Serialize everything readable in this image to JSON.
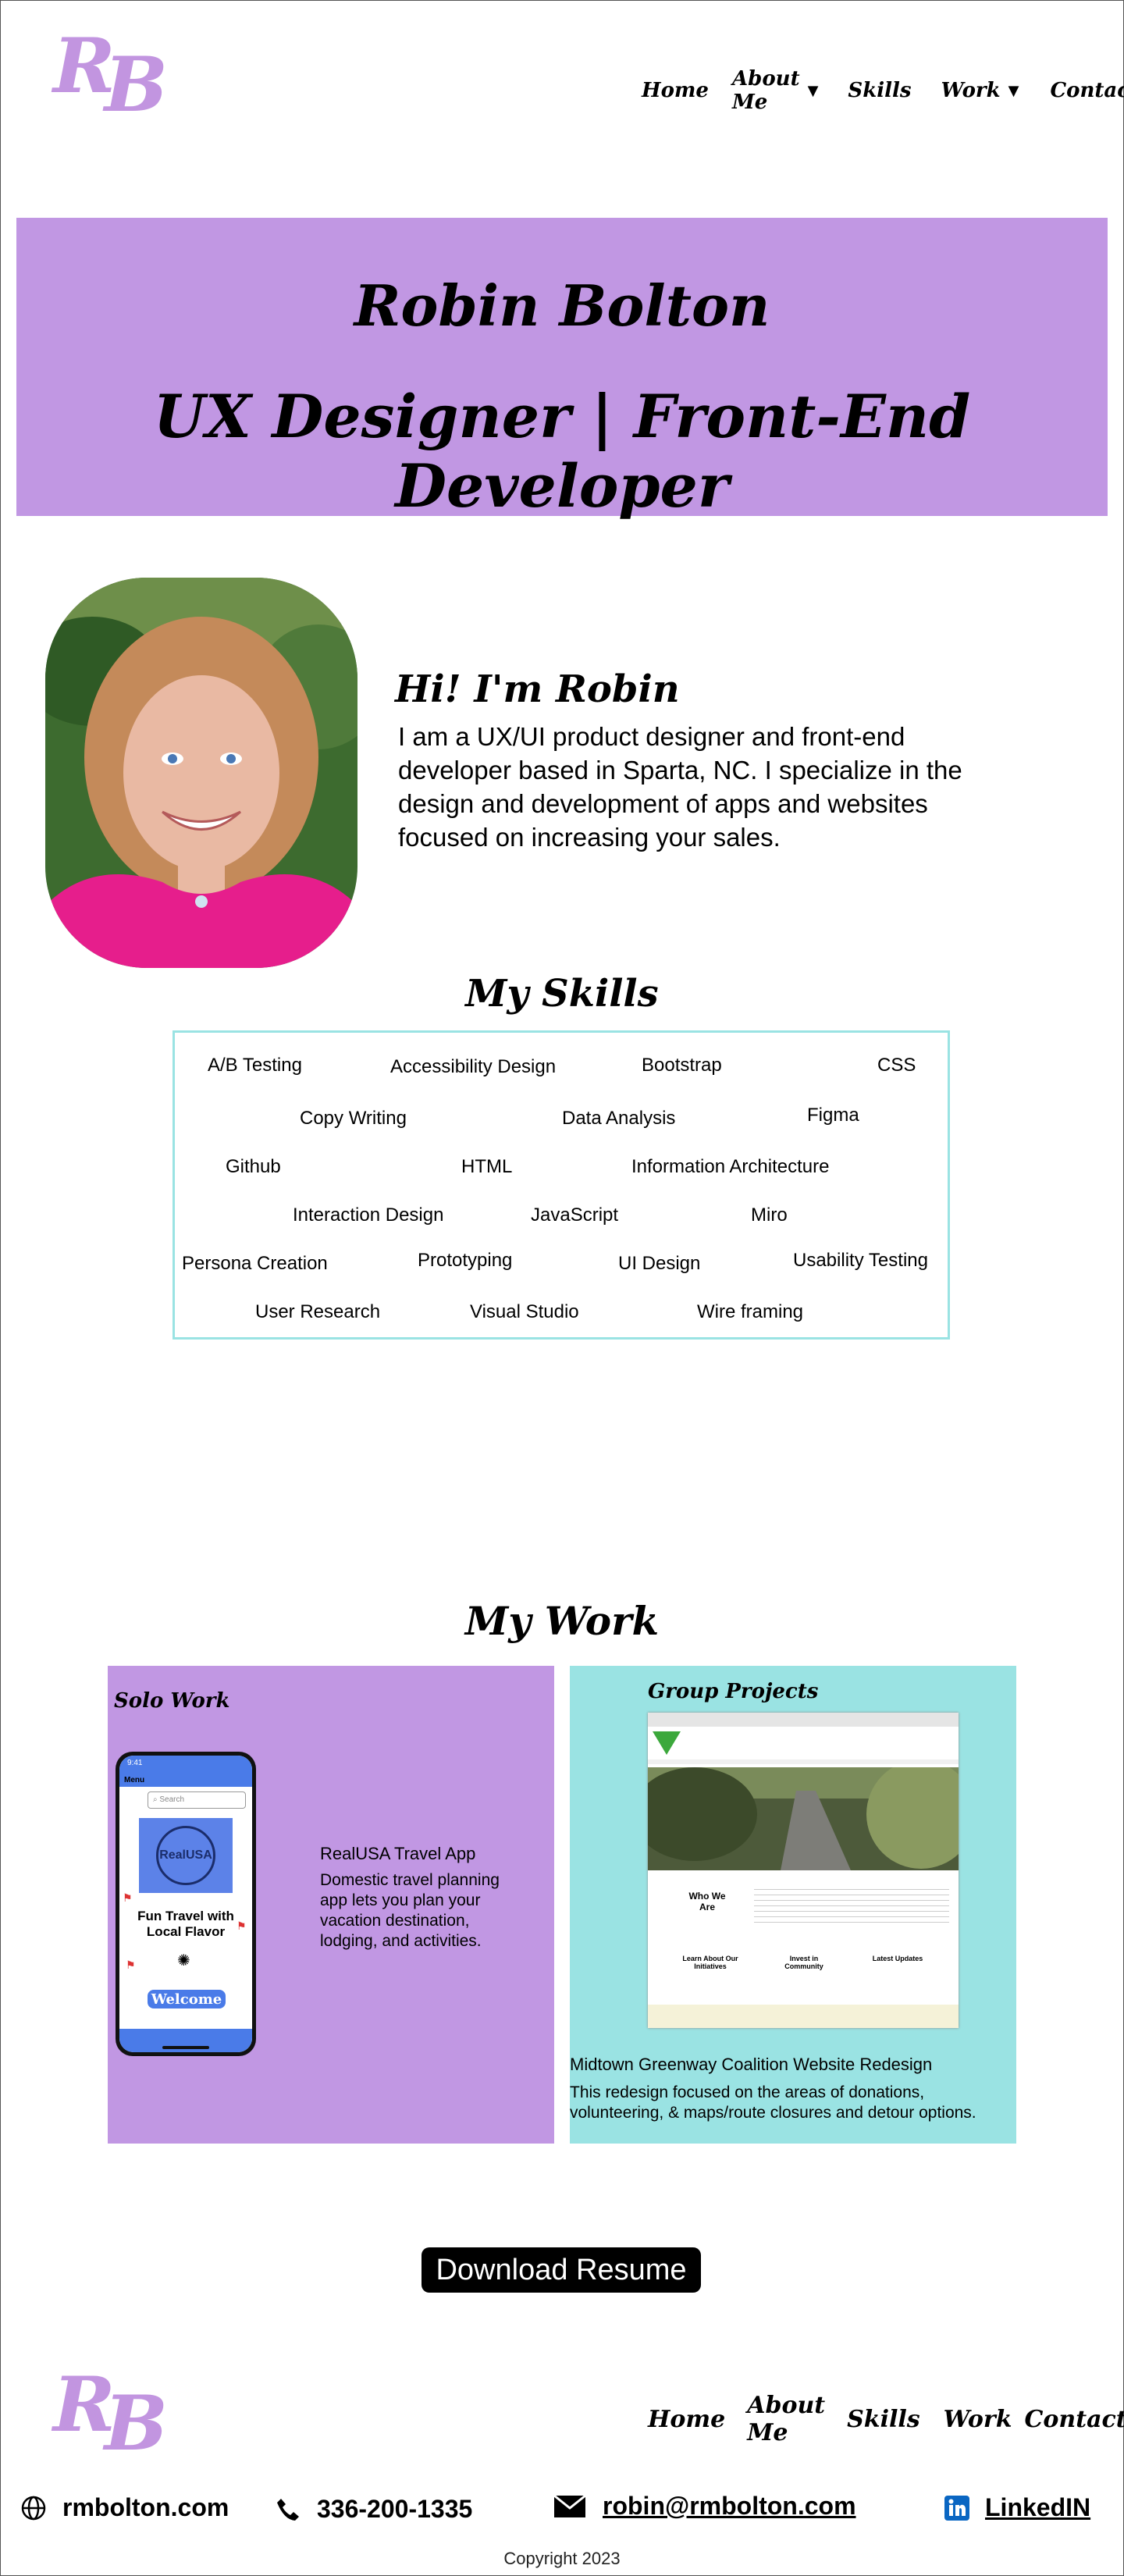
{
  "header": {
    "logo_r": "R",
    "logo_b": "B",
    "nav": {
      "home": "Home",
      "about": "About Me",
      "skills": "Skills",
      "work": "Work",
      "contact": "Contact"
    }
  },
  "hero": {
    "name": "Robin Bolton",
    "role": "UX Designer | Front-End Developer"
  },
  "about": {
    "heading": "Hi! I'm Robin",
    "text": "I am a UX/UI product designer and front-end developer based in Sparta, NC. I specialize in the design and development of apps and websites focused on increasing your sales."
  },
  "skills": {
    "heading": "My Skills",
    "items": [
      "A/B Testing",
      "Accessibility Design",
      "Bootstrap",
      "CSS",
      "Copy Writing",
      "Data Analysis",
      "Figma",
      "Github",
      "HTML",
      "Information Architecture",
      "Interaction Design",
      "JavaScript",
      "Miro",
      "Persona Creation",
      "Prototyping",
      "UI Design",
      "Usability Testing",
      "User Research",
      "Visual Studio",
      "Wire framing"
    ]
  },
  "work": {
    "heading": "My Work",
    "solo": {
      "label": "Solo Work",
      "title": "RealUSA Travel App",
      "desc": "Domestic travel planning app lets you plan your vacation destination, lodging, and activities.",
      "phone": {
        "time": "9:41",
        "menu": "Menu",
        "search": "Search",
        "logo": "RealUSA",
        "tagline": "Fun Travel with Local Flavor",
        "welcome": "Welcome"
      }
    },
    "group": {
      "label": "Group Projects",
      "title": "Midtown Greenway Coalition Website Redesign",
      "desc": "This redesign focused on the areas of donations, volunteering, & maps/route closures and detour options.",
      "site": {
        "who": "Who We Are",
        "learn": "Learn About Our Initiatives",
        "invest": "Invest in Community",
        "latest": "Latest Updates"
      }
    }
  },
  "resume": {
    "label": "Download Resume"
  },
  "footer": {
    "nav": {
      "home": "Home",
      "about": "About Me",
      "skills": "Skills",
      "work": "Work",
      "contact": "Contact"
    },
    "website": "rmbolton.com",
    "phone": "336-200-1335",
    "email": "robin@rmbolton.com",
    "linkedin": "LinkedIN",
    "copyright": "Copyright 2023"
  },
  "colors": {
    "lavender": "#c197e3",
    "aqua": "#9ae3e3",
    "logo": "#c295e0",
    "linkedin_blue": "#0a66c2",
    "welcome_blue": "#4a7be8"
  },
  "icons": [
    "globe-icon",
    "phone-icon",
    "mail-icon",
    "linkedin-icon",
    "caret-down-icon"
  ]
}
